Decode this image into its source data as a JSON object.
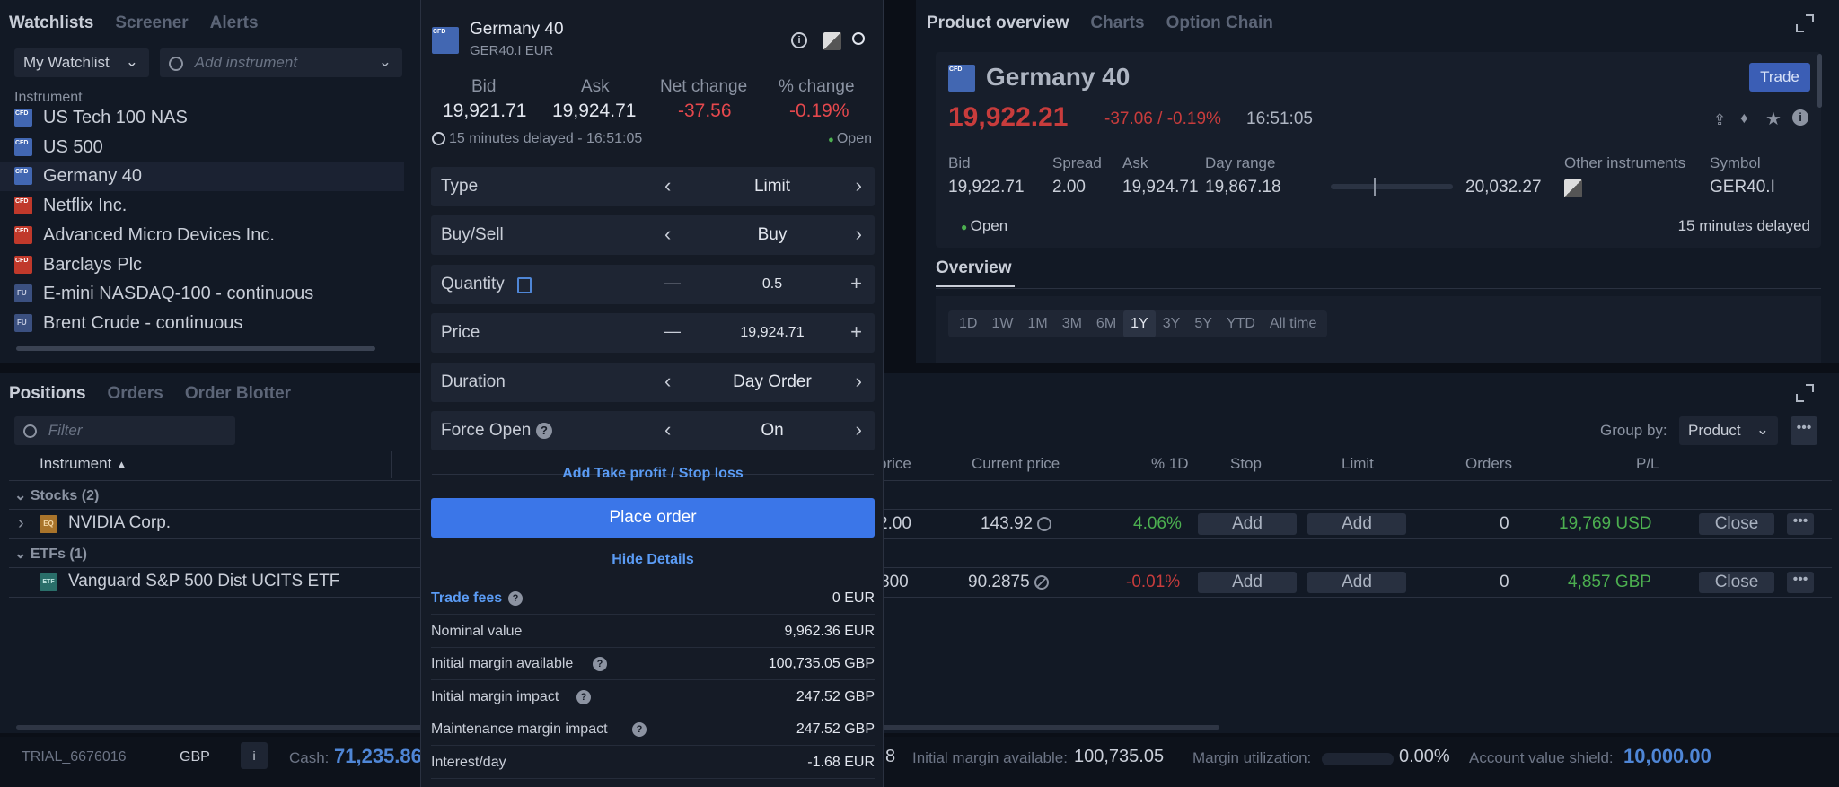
{
  "watchlists": {
    "tabs": [
      "Watchlists",
      "Screener",
      "Alerts"
    ],
    "watchlist_select": "My Watchlist",
    "add_instrument_placeholder": "Add instrument",
    "column_instrument": "Instrument",
    "rows": [
      {
        "name": "US Tech 100 NAS",
        "icon": "cfd-icon"
      },
      {
        "name": "US 500",
        "icon": "cfd-icon"
      },
      {
        "name": "Germany 40",
        "icon": "cfd-icon"
      },
      {
        "name": "Netflix Inc.",
        "icon": "cfd-icon"
      },
      {
        "name": "Advanced Micro Devices Inc.",
        "icon": "cfd-icon"
      },
      {
        "name": "Barclays Plc",
        "icon": "cfd-icon"
      },
      {
        "name": "E-mini NASDAQ-100 - continuous",
        "icon": "fu-icon"
      },
      {
        "name": "Brent Crude - continuous",
        "icon": "fu-icon"
      }
    ]
  },
  "ticket": {
    "name": "Germany 40",
    "code": "GER40.I EUR",
    "quote_labels": [
      "Bid",
      "Ask",
      "Net change",
      "% change"
    ],
    "bid": "19,921.71",
    "ask": "19,924.71",
    "net_change": "-37.56",
    "pct_change": "-0.19%",
    "delay_text": "15 minutes delayed - 16:51:05",
    "status": "Open",
    "fields": [
      {
        "label": "Type",
        "value": "Limit",
        "control": "arrows"
      },
      {
        "label": "Buy/Sell",
        "value": "Buy",
        "control": "arrows"
      },
      {
        "label": "Quantity",
        "value": "0.5",
        "control": "stepper"
      },
      {
        "label": "Price",
        "value": "19,924.71",
        "control": "stepper"
      },
      {
        "label": "Duration",
        "value": "Day Order",
        "control": "arrows"
      },
      {
        "label": "Force Open",
        "value": "On",
        "control": "arrows"
      }
    ],
    "add_tp_sl": "Add Take profit / Stop loss",
    "place_order": "Place order",
    "hide_details": "Hide Details",
    "details": [
      {
        "label": "Trade fees",
        "value": "0 EUR"
      },
      {
        "label": "Nominal value",
        "value": "9,962.36 EUR"
      },
      {
        "label": "Initial margin available",
        "value": "100,735.05 GBP"
      },
      {
        "label": "Initial margin impact",
        "value": "247.52 GBP"
      },
      {
        "label": "Maintenance margin impact",
        "value": "247.52 GBP"
      },
      {
        "label": "Interest/day",
        "value": "-1.68 EUR"
      }
    ]
  },
  "overview": {
    "tabs": [
      "Product overview",
      "Charts",
      "Option Chain"
    ],
    "name": "Germany 40",
    "trade_label": "Trade",
    "price": "19,922.21",
    "change": "-37.06 / -0.19%",
    "time": "16:51:05",
    "stats": [
      {
        "label": "Bid",
        "value": "19,922.71"
      },
      {
        "label": "Spread",
        "value": "2.00"
      },
      {
        "label": "Ask",
        "value": "19,924.71"
      },
      {
        "label": "Day range",
        "value": "19,867.18"
      }
    ],
    "day_range_high": "20,032.27",
    "day_range_position": 0.35,
    "other_instruments": "Other instruments",
    "symbol_label": "Symbol",
    "symbol": "GER40.I",
    "status": "Open",
    "delayed": "15 minutes delayed",
    "section": "Overview",
    "periods": [
      "1D",
      "1W",
      "1M",
      "3M",
      "6M",
      "1Y",
      "3Y",
      "5Y",
      "YTD",
      "All time"
    ],
    "active_period": "1Y"
  },
  "positions": {
    "tabs": [
      "Positions",
      "Orders",
      "Order Blotter"
    ],
    "filter_placeholder": "Filter",
    "group_by_label": "Group by:",
    "group_by_value": "Product",
    "columns": {
      "instrument": "Instrument",
      "open_price": "price",
      "current": "Current price",
      "pct": "% 1D",
      "stop": "Stop",
      "limit": "Limit",
      "orders": "Orders",
      "pl": "P/L"
    },
    "groups": [
      {
        "label": "Stocks (2)"
      },
      {
        "label": "ETFs (1)"
      }
    ],
    "rows": [
      {
        "name": "NVIDIA Corp.",
        "icon": "eq-icon",
        "open": "2.00",
        "current": "143.92",
        "pct": "4.06%",
        "stop": "Add",
        "limit": "Add",
        "orders": "0",
        "pl": "19,769 USD",
        "close": "Close"
      },
      {
        "name": "Vanguard S&P 500 Dist UCITS ETF",
        "icon": "etf-icon",
        "open": "800",
        "current": "90.2875",
        "pct": "-0.01%",
        "stop": "Add",
        "limit": "Add",
        "orders": "0",
        "pl": "4,857 GBP",
        "close": "Close"
      }
    ]
  },
  "footer": {
    "account": "TRIAL_6676016",
    "currency": "GBP",
    "info": "i",
    "cash_label": "Cash:",
    "cash": "71,235.86",
    "partial": "8",
    "margin_available_label": "Initial margin available:",
    "margin_available": "100,735.05",
    "margin_util_label": "Margin utilization:",
    "margin_util": "0.00%",
    "shield_label": "Account value shield:",
    "shield": "10,000.00"
  },
  "colors": {
    "negative": "#e5484d",
    "positive": "#4caf50",
    "accent": "#3b82f6",
    "link": "#5b9cf5"
  }
}
